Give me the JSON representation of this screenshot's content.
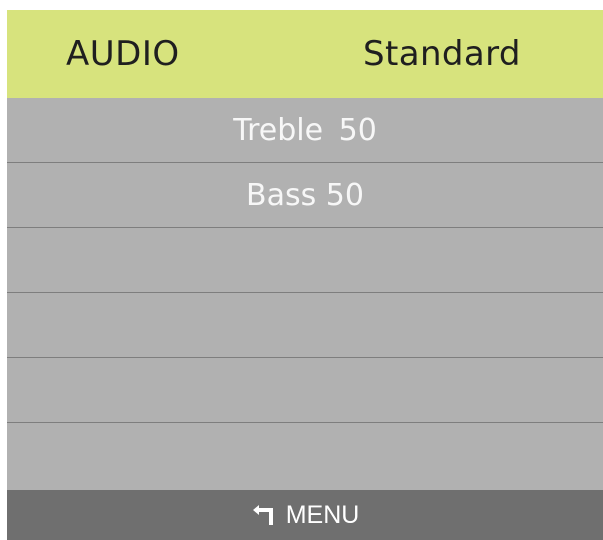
{
  "header": {
    "title": "AUDIO",
    "mode": "Standard"
  },
  "menu": {
    "rows": [
      {
        "label": "Treble  50"
      },
      {
        "label": "Bass 50"
      },
      {
        "label": ""
      },
      {
        "label": ""
      },
      {
        "label": ""
      },
      {
        "label": ""
      }
    ]
  },
  "footer": {
    "icon": "return-arrow-icon",
    "label": "MENU"
  },
  "colors": {
    "header_bg": "#d7e37d",
    "menu_bg": "#b1b1b1",
    "footer_bg": "#6f6f6f",
    "primary_text": "#1f1f1f",
    "menu_text": "#f7f7f7"
  }
}
